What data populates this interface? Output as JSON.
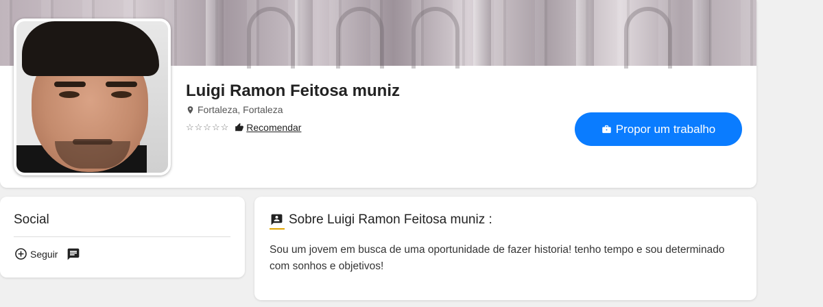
{
  "profile": {
    "name": "Luigi Ramon Feitosa muniz",
    "location": "Fortaleza, Fortaleza",
    "rating_stars": "☆☆☆☆☆",
    "recommend_label": "Recomendar",
    "propose_label": "Propor um trabalho"
  },
  "social": {
    "title": "Social",
    "follow_label": "Seguir"
  },
  "about": {
    "title": "Sobre Luigi Ramon Feitosa muniz :",
    "text": "Sou um jovem em busca de uma oportunidade de fazer historia! tenho tempo e sou determinado com sonhos e objetivos!"
  },
  "colors": {
    "primary_button": "#0a7cff",
    "accent_underline": "#e0a400",
    "background": "#f0f0f0"
  },
  "icons": [
    "map-pin-icon",
    "thumbs-up-icon",
    "briefcase-icon",
    "plus-circle-icon",
    "chat-icon",
    "contact-card-icon"
  ]
}
